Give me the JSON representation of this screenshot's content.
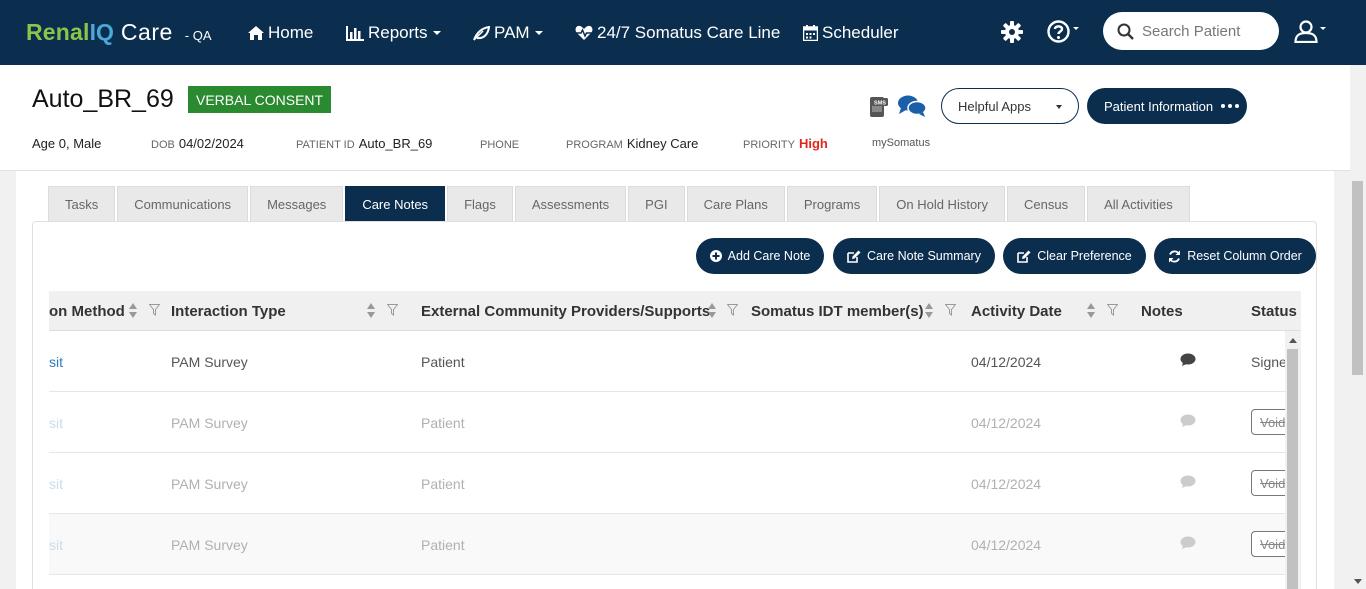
{
  "brand": {
    "part1": "Renal",
    "part2": "IQ",
    "part3": "Care",
    "env": "- QA"
  },
  "nav": {
    "home": "Home",
    "reports": "Reports",
    "pam": "PAM",
    "care_line": "24/7 Somatus Care Line",
    "scheduler": "Scheduler"
  },
  "search": {
    "placeholder": "Search Patient",
    "value": ""
  },
  "patient": {
    "name": "Auto_BR_69",
    "consent": "VERBAL CONSENT",
    "age_sex": "Age 0, Male",
    "dob_label": "DOB",
    "dob": "04/02/2024",
    "id_label": "PATIENT ID",
    "id": "Auto_BR_69",
    "phone_label": "PHONE",
    "program_label": "PROGRAM",
    "program": "Kidney Care",
    "priority_label": "PRIORITY",
    "priority": "High",
    "my_somatus": "mySomatus"
  },
  "header_actions": {
    "helpful_apps": "Helpful Apps",
    "patient_info": "Patient Information",
    "sms_badge": "SMS"
  },
  "tabs": [
    {
      "label": "Tasks"
    },
    {
      "label": "Communications"
    },
    {
      "label": "Messages"
    },
    {
      "label": "Care Notes",
      "active": true
    },
    {
      "label": "Flags"
    },
    {
      "label": "Assessments"
    },
    {
      "label": "PGI"
    },
    {
      "label": "Care Plans"
    },
    {
      "label": "Programs"
    },
    {
      "label": "On Hold History"
    },
    {
      "label": "Census"
    },
    {
      "label": "All Activities"
    }
  ],
  "actions": {
    "add_care_note": "Add Care Note",
    "care_note_summary": "Care Note Summary",
    "clear_preference": "Clear Preference",
    "reset_column_order": "Reset Column Order"
  },
  "grid": {
    "columns": {
      "method": "on Method",
      "interaction_type": "Interaction Type",
      "external": "External Community Providers/Supports",
      "idt": "Somatus IDT member(s)",
      "activity_date": "Activity Date",
      "notes": "Notes",
      "status": "Status"
    },
    "rows": [
      {
        "method": "sit",
        "interaction_type": "PAM Survey",
        "external": "Patient",
        "idt": "",
        "activity_date": "04/12/2024",
        "status": "Signe"
      },
      {
        "method": "sit",
        "interaction_type": "PAM Survey",
        "external": "Patient",
        "idt": "",
        "activity_date": "04/12/2024",
        "status": "Void"
      },
      {
        "method": "sit",
        "interaction_type": "PAM Survey",
        "external": "Patient",
        "idt": "",
        "activity_date": "04/12/2024",
        "status": "Void"
      },
      {
        "method": "sit",
        "interaction_type": "PAM Survey",
        "external": "Patient",
        "idt": "",
        "activity_date": "04/12/2024",
        "status": "Void"
      }
    ]
  },
  "colors": {
    "navy": "#0b2e4f",
    "brand_green": "#8cc44a",
    "brand_blue": "#49a8d8",
    "consent_green": "#2a8a2f",
    "priority_red": "#e0271f"
  }
}
